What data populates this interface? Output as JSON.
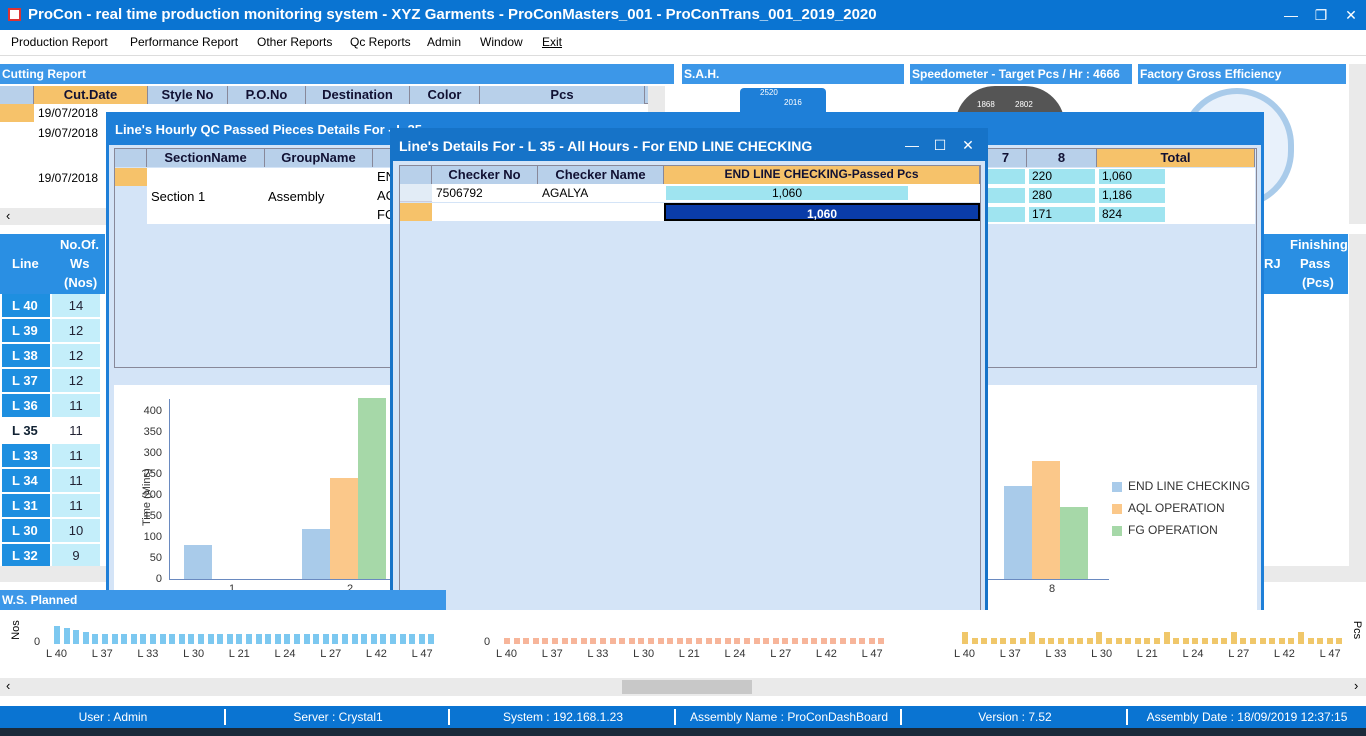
{
  "window": {
    "title": "ProCon - real time production monitoring system - XYZ Garments - ProConMasters_001 - ProConTrans_001_2019_2020"
  },
  "menu": [
    "Production Report",
    "Performance Report",
    "Other Reports",
    "Qc Reports",
    "Admin",
    "Window",
    "Exit"
  ],
  "panels": {
    "cutting": "Cutting Report",
    "sah": "S.A.H.",
    "speedometer": "Speedometer - Target Pcs / Hr : 4666",
    "efficiency": "Factory Gross Efficiency",
    "ws_planned": "W.S. Planned",
    "finishing": "Finishing"
  },
  "cutting": {
    "columns": [
      "Cut.Date",
      "Style No",
      "P.O.No",
      "Destination",
      "Color",
      "Pcs"
    ],
    "rows": [
      [
        "19/07/2018"
      ],
      [
        "19/07/2018"
      ],
      [
        "19/07/2018"
      ]
    ]
  },
  "gauges": {
    "sah_vals": [
      "2520",
      "2016"
    ],
    "speed_vals": [
      "1868",
      "2802"
    ]
  },
  "lines": {
    "header": [
      "Line",
      "No.Of.",
      "Ws",
      "(Nos)"
    ],
    "right_header": [
      "RJ",
      "Pass",
      "(Pcs)"
    ],
    "items": [
      {
        "line": "L 40",
        "ws": "14"
      },
      {
        "line": "L 39",
        "ws": "12"
      },
      {
        "line": "L 38",
        "ws": "12"
      },
      {
        "line": "L 37",
        "ws": "12"
      },
      {
        "line": "L 36",
        "ws": "11"
      },
      {
        "line": "L 35",
        "ws": "11"
      },
      {
        "line": "L 33",
        "ws": "11"
      },
      {
        "line": "L 34",
        "ws": "11"
      },
      {
        "line": "L 31",
        "ws": "11"
      },
      {
        "line": "L 30",
        "ws": "10"
      },
      {
        "line": "L 32",
        "ws": "9"
      }
    ]
  },
  "hourly": {
    "title": "Line's Hourly QC Passed Pieces Details For - L 35",
    "columns": [
      "SectionName",
      "GroupName"
    ],
    "section": "Section 1",
    "group": "Assembly",
    "clipped": [
      "EN",
      "AC",
      "FC"
    ],
    "right_cols": [
      "7",
      "8",
      "Total"
    ],
    "right_rows": [
      [
        "220",
        "1,060"
      ],
      [
        "280",
        "1,186"
      ],
      [
        "171",
        "824"
      ]
    ]
  },
  "details": {
    "title": "Line's  Details For - L 35 - All Hours - For END LINE CHECKING",
    "columns": [
      "Checker No",
      "Checker Name",
      "END LINE CHECKING-Passed Pcs"
    ],
    "rows": [
      {
        "no": "7506792",
        "name": "AGALYA",
        "pcs": "1,060"
      }
    ],
    "total": "1,060"
  },
  "chart_data": {
    "type": "bar",
    "title": "",
    "xlabel": "",
    "ylabel": "Time (Mins)",
    "ylim": [
      0,
      400
    ],
    "yticks": [
      "400",
      "350",
      "300",
      "250",
      "200",
      "150",
      "100",
      "50",
      "0"
    ],
    "categories": [
      "1",
      "2",
      "8"
    ],
    "series": [
      {
        "name": "END LINE CHECKING",
        "color": "#a9cbea",
        "values": [
          80,
          120,
          222
        ]
      },
      {
        "name": "AQL OPERATION",
        "color": "#fbc88a",
        "values": [
          0,
          240,
          282
        ]
      },
      {
        "name": "FG OPERATION",
        "color": "#a6d8a8",
        "values": [
          0,
          430,
          172
        ]
      }
    ]
  },
  "mini_charts": {
    "labels": [
      "L 40",
      "L 37",
      "L 33",
      "L 30",
      "L 21",
      "L 24",
      "L 27",
      "L 42",
      "L 47"
    ],
    "zero": "0",
    "ylabels": [
      "Nos",
      "Pcs"
    ]
  },
  "status": {
    "user": "User : Admin",
    "server": "Server : Crystal1",
    "system": "System : 192.168.1.23",
    "assembly": "Assembly Name : ProConDashBoard",
    "version": "Version : 7.52",
    "date": "Assembly Date : 18/09/2019 12:37:15"
  }
}
